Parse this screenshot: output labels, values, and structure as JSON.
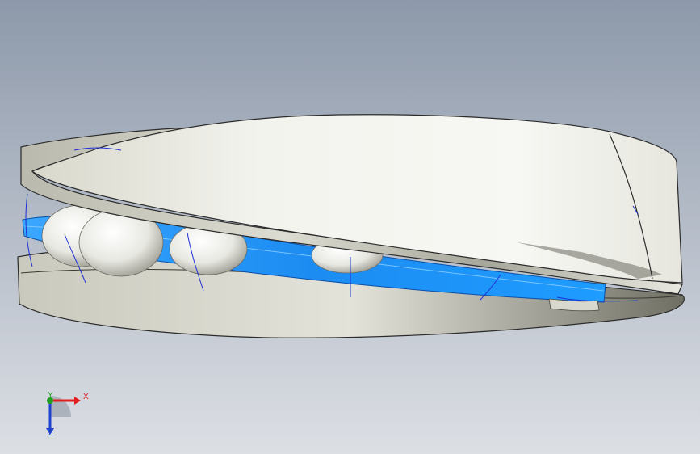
{
  "viewport": {
    "background_top": "#8e9aab",
    "background_bottom": "#dadde2",
    "model": "bearing-assembly",
    "colors": {
      "ring_surface_light": "#f4f4ef",
      "ring_surface_mid": "#d6d6cb",
      "ring_surface_dark": "#8a8a7e",
      "cage_blue": "#1c8cf2",
      "cage_blue_dark": "#0b5fc4",
      "edge_line": "#2b2b2b",
      "sketch_line": "#1f2fd8"
    }
  },
  "triad": {
    "x_label": "X",
    "y_label": "Y",
    "z_label": "Z",
    "x_color": "#e02020",
    "y_color": "#20a020",
    "z_color": "#2040d0"
  }
}
